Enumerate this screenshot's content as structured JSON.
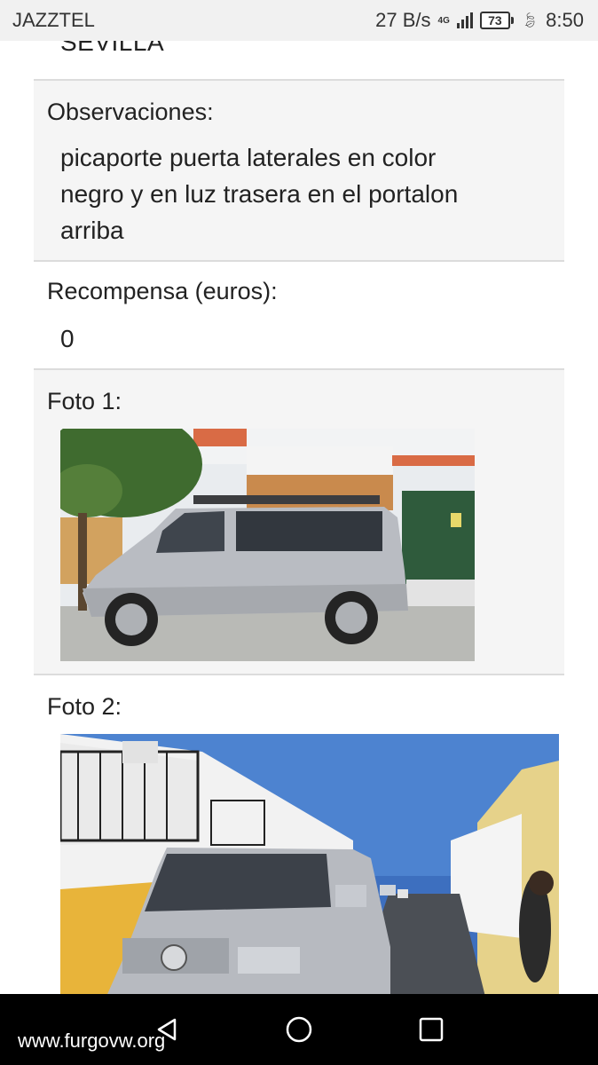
{
  "status_bar": {
    "carrier": "JAZZTEL",
    "data_rate": "27 B/s",
    "network": "4G",
    "battery": "73",
    "time": "8:50"
  },
  "details": {
    "city_value": "SEVILLA",
    "observaciones_label": "Observaciones:",
    "observaciones_lines": [
      "picaporte puerta laterales en color",
      "negro y en luz trasera en el portalon",
      "arriba"
    ],
    "recompensa_label": "Recompensa (euros):",
    "recompensa_value": "0",
    "foto1_label": "Foto 1:",
    "foto2_label": "Foto 2:"
  },
  "nav_bar": {
    "icons": [
      "back-icon",
      "home-icon",
      "recents-icon"
    ]
  },
  "watermark": "www.furgovw.org",
  "colors": {
    "status_bar_bg": "#f1f1f1",
    "section_gray_bg": "#f5f5f5",
    "divider": "#dcdcdc",
    "nav_bar_bg": "#000000",
    "van_silver": "#b9bcc2"
  }
}
